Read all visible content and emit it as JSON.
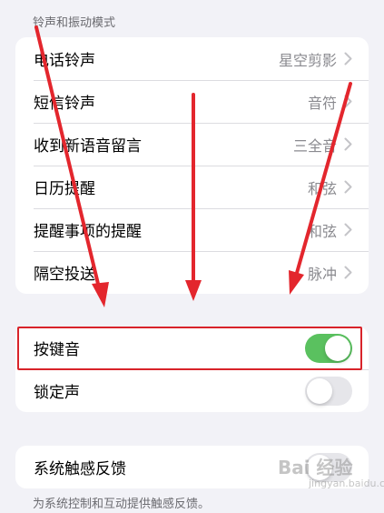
{
  "section_header": "铃声和振动模式",
  "ringtone_rows": [
    {
      "label": "电话铃声",
      "value": "星空剪影"
    },
    {
      "label": "短信铃声",
      "value": "音符"
    },
    {
      "label": "收到新语音留言",
      "value": "三全音"
    },
    {
      "label": "日历提醒",
      "value": "和弦"
    },
    {
      "label": "提醒事项的提醒",
      "value": "和弦"
    },
    {
      "label": "隔空投送",
      "value": "脉冲"
    }
  ],
  "sound_toggles": [
    {
      "label": "按键音",
      "on": true
    },
    {
      "label": "锁定声",
      "on": false
    }
  ],
  "haptics": {
    "label": "系统触感反馈",
    "on": false
  },
  "footer_text": "为系统控制和互动提供触感反馈。",
  "watermark": "Bai 经验",
  "watermark_sub": "jingyan.baidu.com",
  "colors": {
    "toggle_on": "#5ac15f",
    "annotation": "#d8232a"
  }
}
